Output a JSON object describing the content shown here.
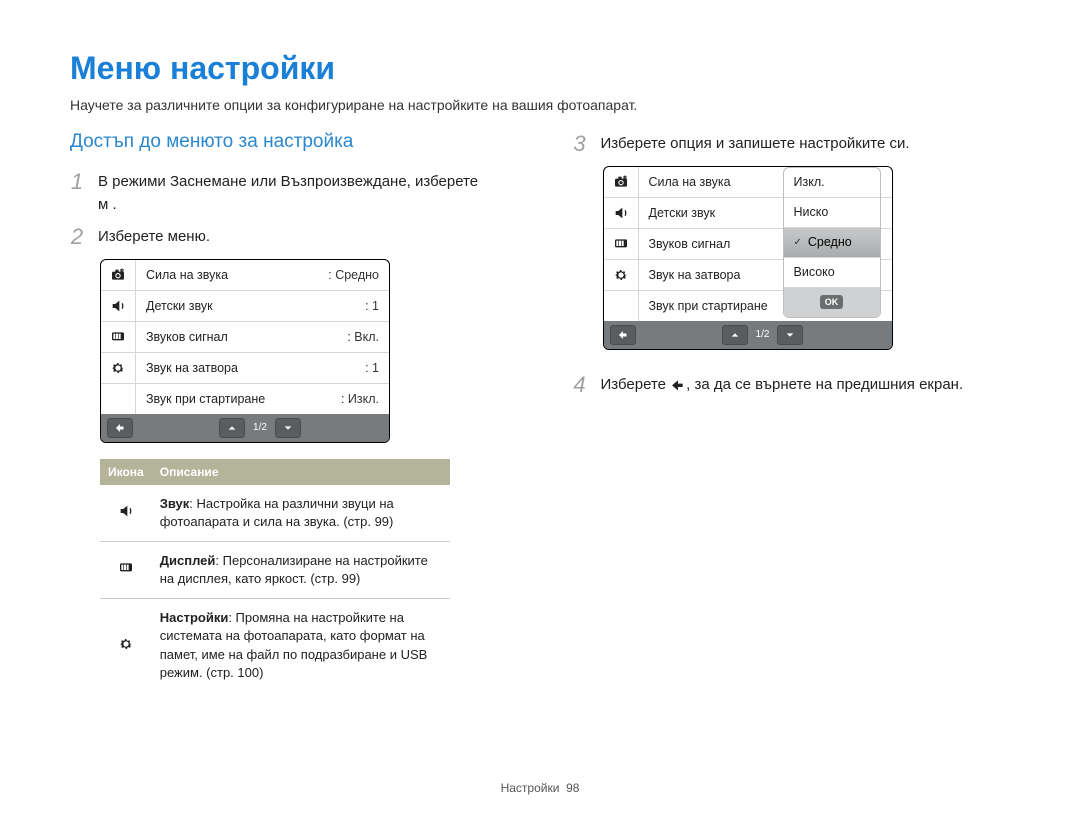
{
  "header": {
    "title": "Меню настройки",
    "subtitle": "Научете за различните опции за конфигуриране на настройките на вашия фотоапарат."
  },
  "section_heading": "Достъп до менюто за настройка",
  "steps": {
    "s1": {
      "num": "1",
      "text_a": "В режими Заснемане или Възпроизвеждане, изберете",
      "text_b": "м       ."
    },
    "s2": {
      "num": "2",
      "text": "Изберете меню."
    },
    "s3": {
      "num": "3",
      "text": "Изберете опция и запишете настройките си."
    },
    "s4": {
      "num": "4",
      "text_a": "Изберете ",
      "text_b": ", за да се върнете на предишния екран."
    }
  },
  "icons": {
    "camera": "camera-icon",
    "speaker": "speaker-icon",
    "display": "display-icon",
    "gear": "gear-icon",
    "back": "back-icon",
    "up": "chevron-up-icon",
    "down": "chevron-down-icon",
    "ok": "OK"
  },
  "screen1": {
    "rows": [
      {
        "label": "Сила на звука",
        "value": "Средно"
      },
      {
        "label": "Детски звук",
        "value": "1"
      },
      {
        "label": "Звуков сигнал",
        "value": "Вкл."
      },
      {
        "label": "Звук на затвора",
        "value": "1"
      },
      {
        "label": "Звук при стартиране",
        "value": "Изкл."
      }
    ],
    "pager": "1/2"
  },
  "desc_table": {
    "head_icon": "Икона",
    "head_desc": "Описание",
    "rows": [
      {
        "icon": "speaker",
        "bold": "Звук",
        "rest": ": Настройка на различни звуци на фотоапарата и сила на звука. (стр. 99)"
      },
      {
        "icon": "display",
        "bold": "Дисплей",
        "rest": ": Персонализиране на настройките на дисплея, като яркост. (стр. 99)"
      },
      {
        "icon": "gear",
        "bold": "Настройки",
        "rest": ": Промяна на настройките на системата на фотоапарата, като формат на памет, име на файл по подразбиране и USB режим. (стр. 100)"
      }
    ]
  },
  "screen2": {
    "rows": [
      {
        "label": "Сила на звука"
      },
      {
        "label": "Детски звук"
      },
      {
        "label": "Звуков сигнал"
      },
      {
        "label": "Звук на затвора"
      },
      {
        "label": "Звук при стартиране"
      }
    ],
    "options": [
      "Изкл.",
      "Ниско",
      "Средно",
      "Високо"
    ],
    "selected": "Средно",
    "pager": "1/2"
  },
  "footer": {
    "section": "Настройки",
    "page": "98"
  }
}
